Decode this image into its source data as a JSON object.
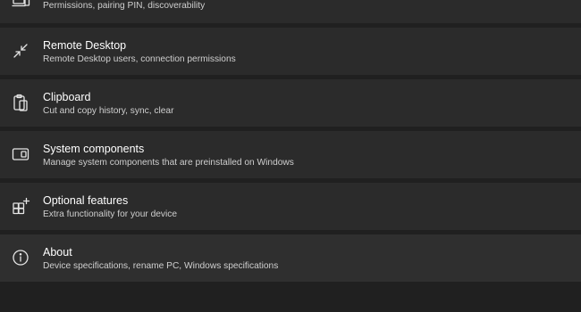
{
  "settings": {
    "items": [
      {
        "title": "",
        "description": "Permissions, pairing PIN, discoverability",
        "icon": "laptop-phone-icon"
      },
      {
        "title": "Remote Desktop",
        "description": "Remote Desktop users, connection permissions",
        "icon": "remote-desktop-icon"
      },
      {
        "title": "Clipboard",
        "description": "Cut and copy history, sync, clear",
        "icon": "clipboard-icon"
      },
      {
        "title": "System components",
        "description": "Manage system components that are preinstalled on Windows",
        "icon": "system-components-icon"
      },
      {
        "title": "Optional features",
        "description": "Extra functionality for your device",
        "icon": "optional-features-icon"
      },
      {
        "title": "About",
        "description": "Device specifications, rename PC, Windows specifications",
        "icon": "info-icon"
      }
    ]
  },
  "colors": {
    "background": "#202020",
    "card": "#2b2b2b",
    "text_primary": "#ffffff",
    "text_secondary": "#cfcfcf"
  }
}
